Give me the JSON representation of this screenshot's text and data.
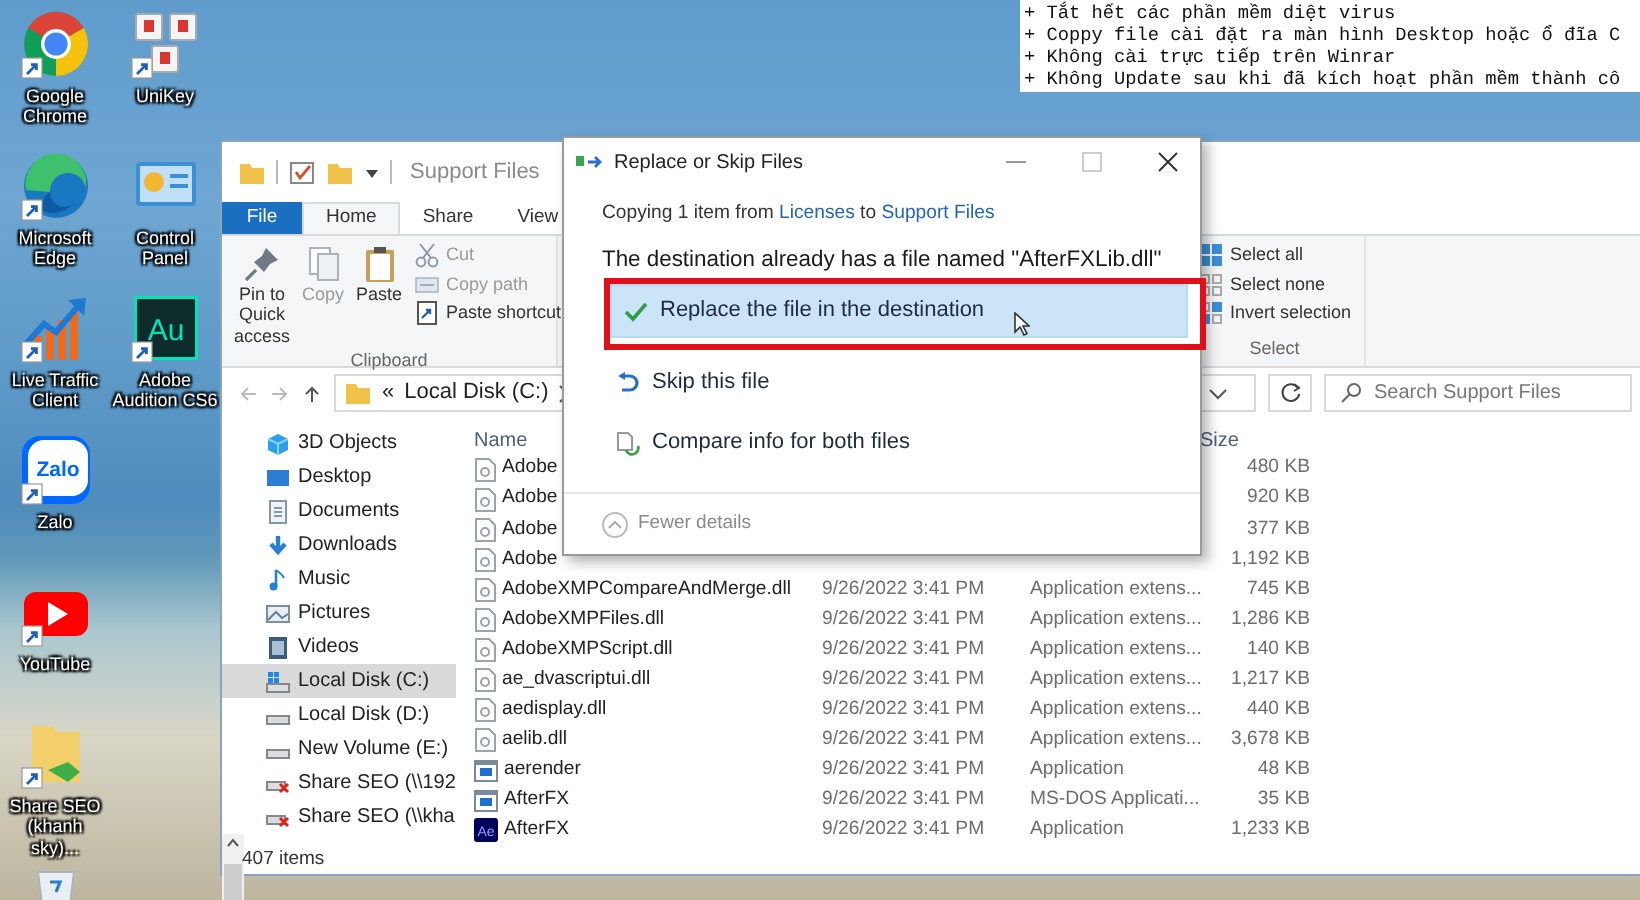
{
  "desktop_icons": [
    [
      {
        "label": "Google Chrome",
        "kind": "chrome",
        "shortcut": true
      },
      {
        "label": "UniKey",
        "kind": "unikey",
        "shortcut": true
      }
    ],
    [
      {
        "label": "Microsoft Edge",
        "kind": "edge",
        "shortcut": true
      },
      {
        "label": "Control Panel",
        "kind": "control-panel",
        "shortcut": false
      }
    ],
    [
      {
        "label": "Live Traffic Client",
        "kind": "chart",
        "shortcut": true
      },
      {
        "label": "Adobe Audition CS6",
        "kind": "app-tile",
        "glyph": "Au",
        "shortcut": true
      }
    ],
    [
      {
        "label": "Zalo",
        "kind": "chat-tile",
        "glyph": "Zalo",
        "shortcut": true
      }
    ],
    [
      {
        "label": "YouTube",
        "kind": "play",
        "shortcut": true
      }
    ],
    [
      {
        "label": "Share SEO (khanh sky)...",
        "kind": "folder",
        "shortcut": true
      }
    ],
    [
      {
        "kind": "recycle-bin"
      }
    ]
  ],
  "notepad": {
    "lines": [
      "+ Tắt hết các phần mềm diệt virus",
      "+ Coppy file cài đặt ra màn hình Desktop hoặc ổ đĩa C",
      "+ Không cài trực tiếp trên Winrar",
      "+ Không Update sau khi đã kích hoạt phần mềm thành cô"
    ]
  },
  "explorer": {
    "title": "Support Files",
    "tabs": [
      {
        "label": "File",
        "kind": "file",
        "selected": false
      },
      {
        "label": "Home",
        "kind": "tab",
        "selected": true
      },
      {
        "label": "Share",
        "kind": "tab",
        "selected": false
      },
      {
        "label": "View",
        "kind": "tab",
        "selected": false
      }
    ],
    "ribbon": {
      "clipboard": {
        "label": "Clipboard",
        "large": [
          {
            "label": "Pin to Quick access",
            "kind": "pin",
            "disabled": false
          },
          {
            "label": "Copy",
            "kind": "copy",
            "disabled": true
          },
          {
            "label": "Paste",
            "kind": "paste",
            "disabled": false
          }
        ],
        "small": [
          {
            "label": "Cut",
            "kind": "cut",
            "disabled": true
          },
          {
            "label": "Copy path",
            "kind": "copy-path",
            "disabled": true
          },
          {
            "label": "Paste shortcut",
            "kind": "paste-shortcut",
            "disabled": false
          }
        ]
      },
      "select": {
        "label": "Select",
        "small": [
          {
            "label": "Select all",
            "kind": "select-all",
            "disabled": false
          },
          {
            "label": "Select none",
            "kind": "select-none",
            "disabled": false
          },
          {
            "label": "Invert selection",
            "kind": "invert",
            "disabled": false
          }
        ]
      }
    },
    "address": {
      "prefix": "«",
      "location": "Local Disk (C:)"
    },
    "search": {
      "placeholder": "Search Support Files"
    },
    "sidebar": {
      "items": [
        {
          "label": "3D Objects",
          "kind": "cube",
          "selected": false
        },
        {
          "label": "Desktop",
          "kind": "desktop",
          "selected": false
        },
        {
          "label": "Documents",
          "kind": "documents",
          "selected": false
        },
        {
          "label": "Downloads",
          "kind": "downloads",
          "selected": false
        },
        {
          "label": "Music",
          "kind": "music",
          "selected": false
        },
        {
          "label": "Pictures",
          "kind": "pictures",
          "selected": false
        },
        {
          "label": "Videos",
          "kind": "videos",
          "selected": false
        },
        {
          "label": "Local Disk (C:)",
          "kind": "system-drive",
          "selected": true
        },
        {
          "label": "Local Disk (D:)",
          "kind": "drive",
          "selected": false
        },
        {
          "label": "New Volume (E:)",
          "kind": "drive",
          "selected": false
        },
        {
          "label": "Share SEO (\\\\192",
          "kind": "network-drive",
          "selected": false
        },
        {
          "label": "Share SEO (\\\\kha",
          "kind": "network-drive",
          "selected": false
        }
      ]
    },
    "table": {
      "columns": [
        "Name",
        "Size"
      ],
      "rows": [
        {
          "name": "Adobe",
          "kind": "dll",
          "size": "480 KB"
        },
        {
          "name": "Adobe",
          "kind": "dll",
          "size": "920 KB"
        },
        {
          "name": "Adobe",
          "kind": "dll",
          "size": "377 KB"
        },
        {
          "name": "Adobe",
          "kind": "dll",
          "size": "1,192 KB"
        },
        {
          "name": "AdobeXMPCompareAndMerge.dll",
          "kind": "dll",
          "date": "9/26/2022 3:41 PM",
          "type": "Application extens...",
          "size": "745 KB"
        },
        {
          "name": "AdobeXMPFiles.dll",
          "kind": "dll",
          "date": "9/26/2022 3:41 PM",
          "type": "Application extens...",
          "size": "1,286 KB"
        },
        {
          "name": "AdobeXMPScript.dll",
          "kind": "dll",
          "date": "9/26/2022 3:41 PM",
          "type": "Application extens...",
          "size": "140 KB"
        },
        {
          "name": "ae_dvascriptui.dll",
          "kind": "dll",
          "date": "9/26/2022 3:41 PM",
          "type": "Application extens...",
          "size": "1,217 KB"
        },
        {
          "name": "aedisplay.dll",
          "kind": "dll",
          "date": "9/26/2022 3:41 PM",
          "type": "Application extens...",
          "size": "440 KB"
        },
        {
          "name": "aelib.dll",
          "kind": "dll",
          "date": "9/26/2022 3:41 PM",
          "type": "Application extens...",
          "size": "3,678 KB"
        },
        {
          "name": "aerender",
          "kind": "exe",
          "date": "9/26/2022 3:41 PM",
          "type": "Application",
          "size": "48 KB"
        },
        {
          "name": "AfterFX",
          "kind": "exe",
          "date": "9/26/2022 3:41 PM",
          "type": "MS-DOS Applicati...",
          "size": "35 KB"
        },
        {
          "name": "AfterFX",
          "kind": "ae",
          "glyph": "Ae",
          "date": "9/26/2022 3:41 PM",
          "type": "Application",
          "size": "1,233 KB"
        }
      ]
    },
    "status_bar": "407 items"
  },
  "dialog": {
    "title": "Replace or Skip Files",
    "copy_line": {
      "prefix": "Copying 1 item from",
      "source": "Licenses",
      "middle": "to",
      "destination": "Support Files"
    },
    "heading": "The destination already has a file named \"AfterFXLib.dll\"",
    "options": [
      {
        "label": "Replace the file in the destination",
        "kind": "replace",
        "hovered": true,
        "annotated": true
      },
      {
        "label": "Skip this file",
        "kind": "skip",
        "hovered": false,
        "annotated": false
      },
      {
        "label": "Compare info for both files",
        "kind": "compare",
        "hovered": false,
        "annotated": false
      }
    ],
    "details_toggle": "Fewer details"
  }
}
